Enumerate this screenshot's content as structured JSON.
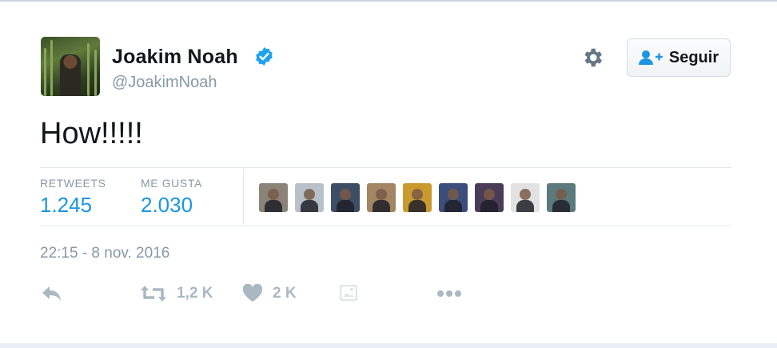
{
  "user": {
    "name": "Joakim Noah",
    "handle": "@JoakimNoah",
    "verified_icon": "verified-badge-icon"
  },
  "header": {
    "settings_icon": "gear-icon",
    "follow_label": "Seguir",
    "follow_icon": "person-add-icon"
  },
  "tweet": {
    "text": "How!!!!!"
  },
  "stats": {
    "retweets_label": "RETWEETS",
    "retweets_value": "1.245",
    "likes_label": "ME GUSTA",
    "likes_value": "2.030"
  },
  "likers": [
    {
      "color": "#8c8378"
    },
    {
      "color": "#b9c1c8"
    },
    {
      "color": "#3d4d63"
    },
    {
      "color": "#a38562"
    },
    {
      "color": "#c99a2e"
    },
    {
      "color": "#3b4d7a"
    },
    {
      "color": "#4a3b58"
    },
    {
      "color": "#e2e2e2"
    },
    {
      "color": "#5a7a7e"
    }
  ],
  "timestamp": "22:15 - 8 nov. 2016",
  "actions": {
    "reply_icon": "reply-icon",
    "retweet_icon": "retweet-icon",
    "retweet_count": "1,2 K",
    "like_icon": "heart-icon",
    "like_count": "2 K",
    "media_icon": "image-icon",
    "more_icon": "more-icon"
  },
  "colors": {
    "accent": "#1b95e0",
    "text": "#14171a",
    "muted": "#8899a6",
    "icon": "#aab8c2"
  }
}
